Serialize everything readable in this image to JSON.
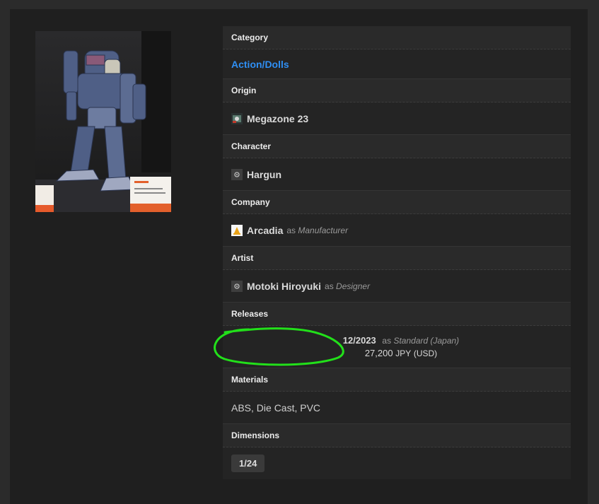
{
  "sections": {
    "category": {
      "label": "Category",
      "value": "Action/Dolls"
    },
    "origin": {
      "label": "Origin",
      "value": "Megazone 23",
      "icon": "series-thumbnail-icon"
    },
    "character": {
      "label": "Character",
      "value": "Hargun",
      "icon": "placeholder-icon"
    },
    "company": {
      "label": "Company",
      "value": "Arcadia",
      "role": "Manufacturer",
      "as": "as",
      "icon": "company-logo-icon"
    },
    "artist": {
      "label": "Artist",
      "value": "Motoki Hiroyuki",
      "role": "Designer",
      "as": "as",
      "icon": "placeholder-icon"
    },
    "releases": {
      "label": "Releases",
      "date": "12/2023",
      "as": "as",
      "edition": "Standard (Japan)",
      "price": "27,200",
      "currency": "JPY",
      "alt_currency": "(USD)"
    },
    "materials": {
      "label": "Materials",
      "value": "ABS, Die Cast, PVC"
    },
    "dimensions": {
      "label": "Dimensions",
      "value": "1/24"
    }
  },
  "colors": {
    "link": "#2f8ff4",
    "highlight_circle": "#22e01a",
    "panel": "#1f1f1f",
    "background": "#2b2b2b"
  }
}
